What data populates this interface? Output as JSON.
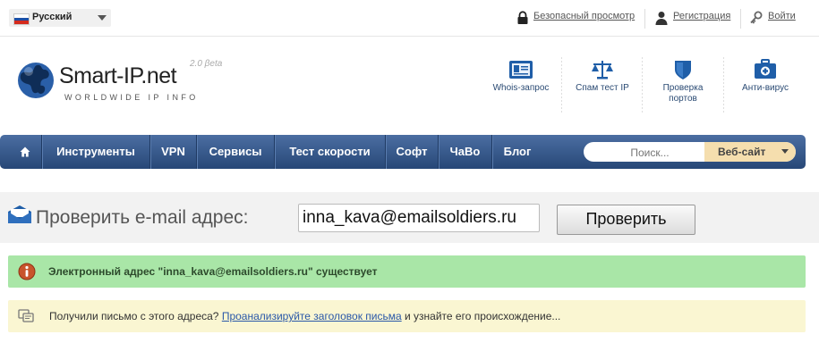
{
  "topbar": {
    "language": "Русский",
    "links": {
      "safe_browsing": "Безопасный просмотр",
      "register": "Регистрация",
      "login": "Войти"
    }
  },
  "header": {
    "logo_title": "Smart-IP.net",
    "logo_subtitle": "WORLDWIDE IP INFO",
    "version": "2.0 βeta",
    "tools": [
      {
        "label": "Whois-запрос",
        "icon": "whois-card-icon"
      },
      {
        "label": "Спам тест IP",
        "icon": "scales-icon"
      },
      {
        "label": "Проверка портов",
        "icon": "shield-icon"
      },
      {
        "label": "Анти-вирус",
        "icon": "medkit-icon"
      }
    ]
  },
  "nav": {
    "items": [
      "Инструменты",
      "VPN",
      "Сервисы",
      "Тест скорости",
      "Софт",
      "ЧаВо",
      "Блог"
    ],
    "search_placeholder": "Поиск...",
    "search_scope": "Веб-сайт"
  },
  "check": {
    "label": "Проверить e-mail адрес:",
    "email_value": "inna_kava@emailsoldiers.ru",
    "button": "Проверить"
  },
  "result": {
    "text": "Электронный адрес \"inna_kava@emailsoldiers.ru\" существует"
  },
  "hint": {
    "prefix": "Получили письмо с этого адреса?",
    "link": "Проанализируйте заголовок письма",
    "suffix": "и узнайте его происхождение..."
  },
  "colors": {
    "nav_top": "#4b6ea2",
    "nav_bottom": "#274777",
    "result_bg": "#a9e6a7",
    "hint_bg": "#faf6d2",
    "link": "#2a58a8"
  }
}
